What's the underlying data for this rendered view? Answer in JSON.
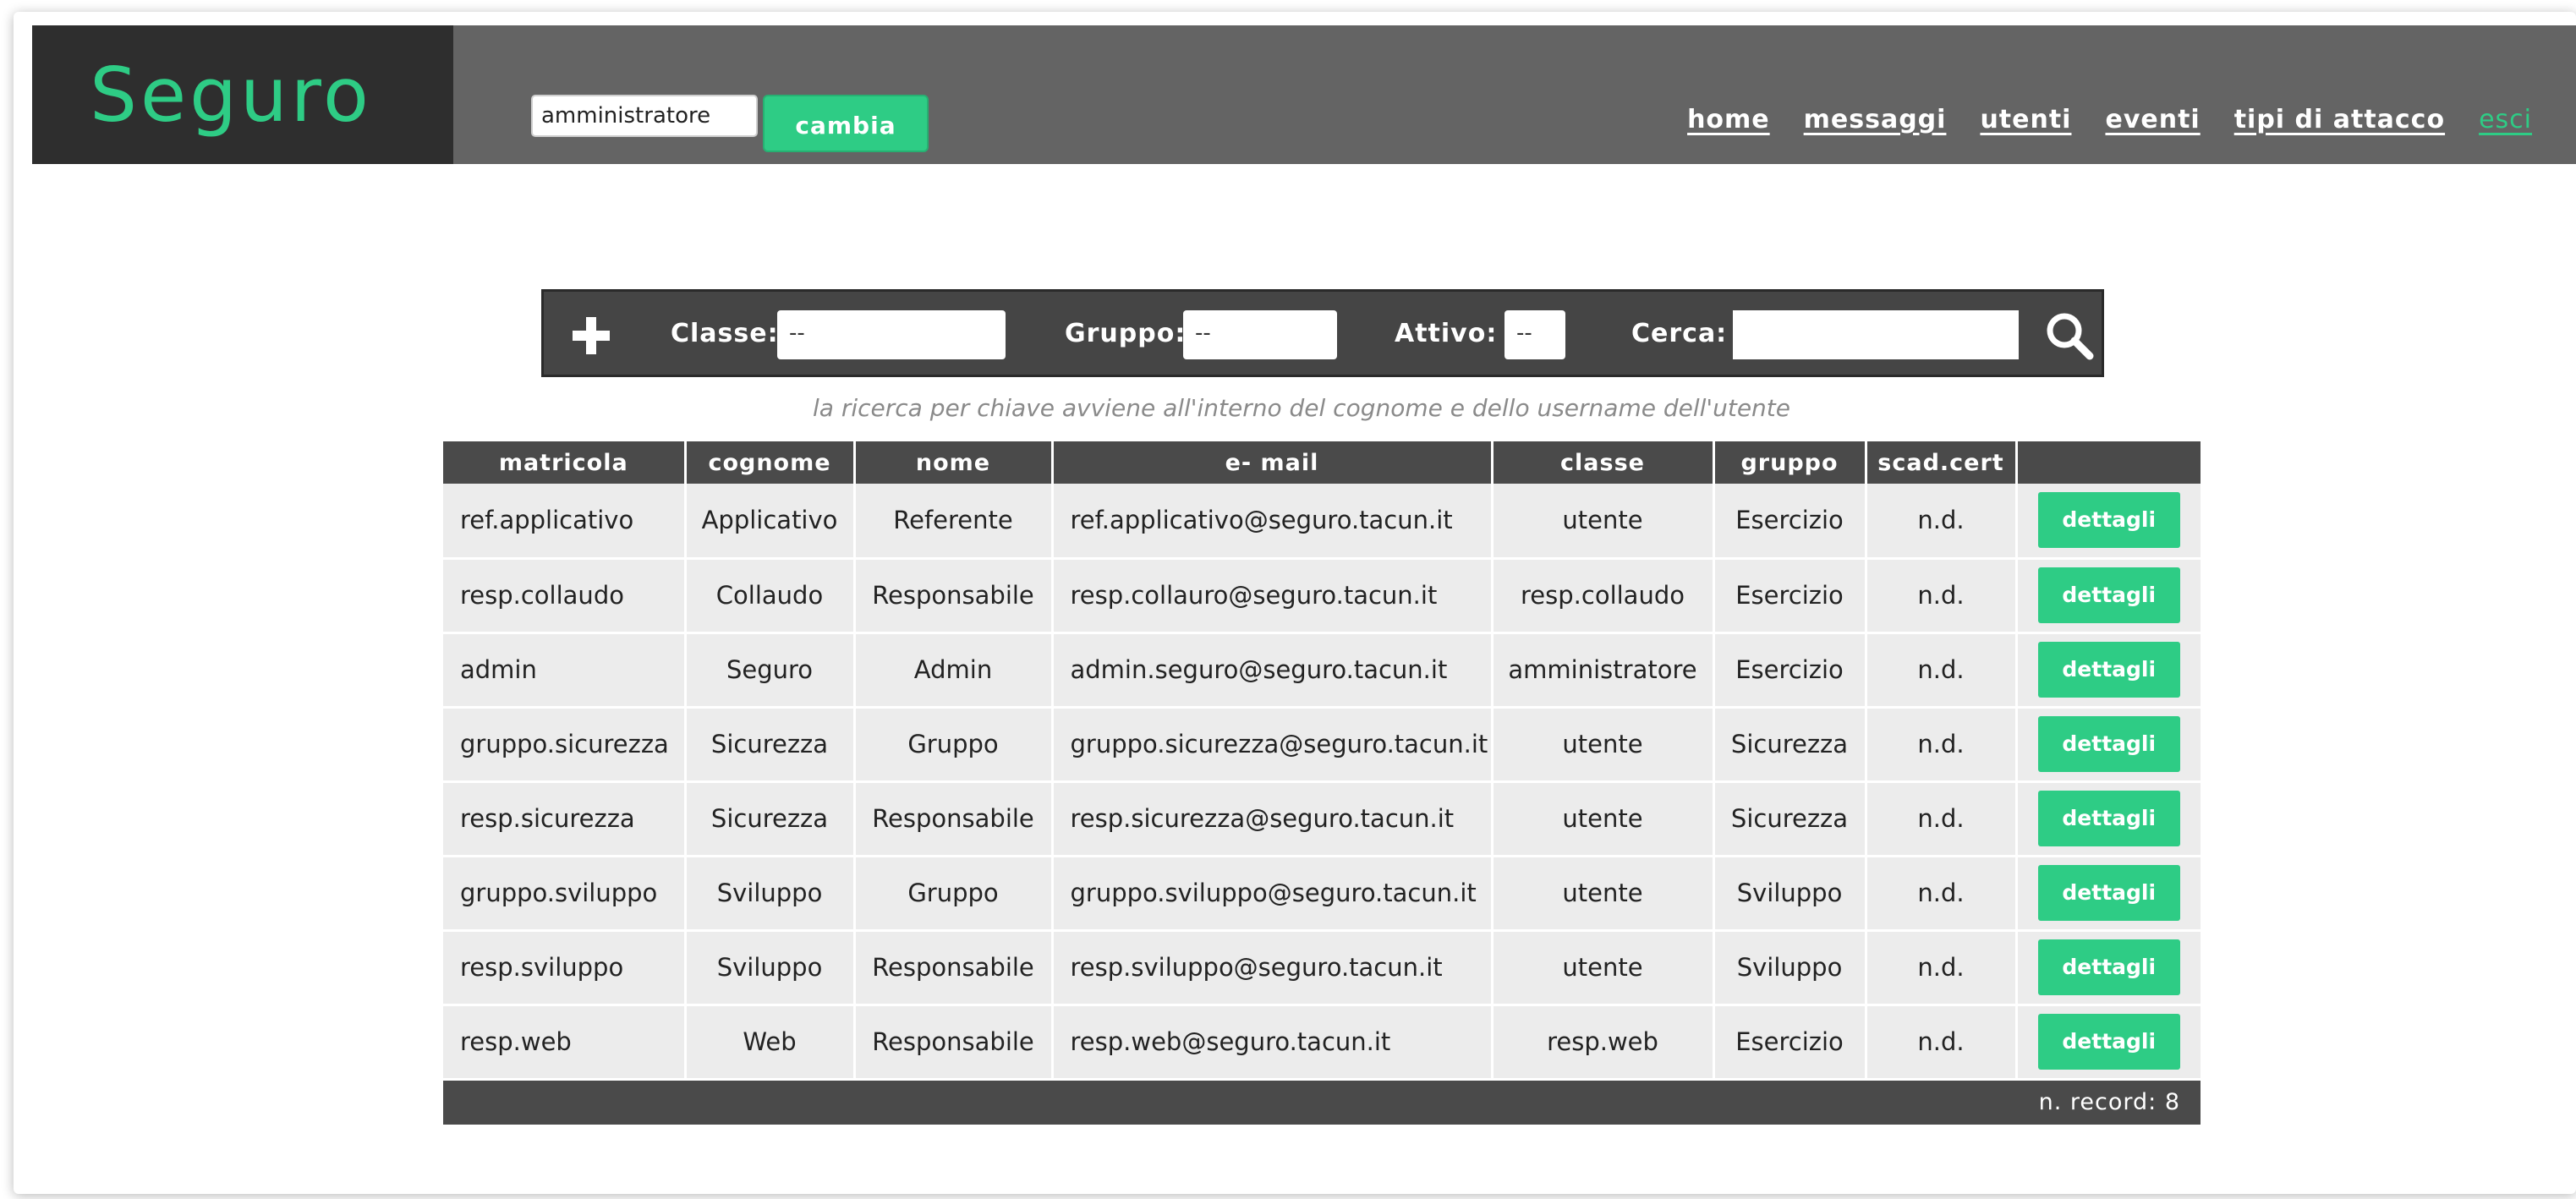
{
  "header": {
    "logo": "Seguro",
    "role_value": "amministratore",
    "change_button": "cambia",
    "nav": [
      {
        "label": "home"
      },
      {
        "label": "messaggi"
      },
      {
        "label": "utenti"
      },
      {
        "label": "eventi"
      },
      {
        "label": "tipi di attacco"
      },
      {
        "label": "esci"
      }
    ]
  },
  "filters": {
    "classe_label": "Classe:",
    "classe_value": "--",
    "gruppo_label": "Gruppo:",
    "gruppo_value": "--",
    "attivo_label": "Attivo:",
    "attivo_value": "--",
    "cerca_label": "Cerca:",
    "cerca_value": ""
  },
  "hint": "la ricerca per chiave avviene all'interno del cognome e dello username dell'utente",
  "table": {
    "columns": [
      "matricola",
      "cognome",
      "nome",
      "e- mail",
      "classe",
      "gruppo",
      "scad.cert",
      ""
    ],
    "rows": [
      [
        "ref.applicativo",
        "Applicativo",
        "Referente",
        "ref.applicativo@seguro.tacun.it",
        "utente",
        "Esercizio",
        "n.d.",
        "dettagli"
      ],
      [
        "resp.collaudo",
        "Collaudo",
        "Responsabile",
        "resp.collauro@seguro.tacun.it",
        "resp.collaudo",
        "Esercizio",
        "n.d.",
        "dettagli"
      ],
      [
        "admin",
        "Seguro",
        "Admin",
        "admin.seguro@seguro.tacun.it",
        "amministratore",
        "Esercizio",
        "n.d.",
        "dettagli"
      ],
      [
        "gruppo.sicurezza",
        "Sicurezza",
        "Gruppo",
        "gruppo.sicurezza@seguro.tacun.it",
        "utente",
        "Sicurezza",
        "n.d.",
        "dettagli"
      ],
      [
        "resp.sicurezza",
        "Sicurezza",
        "Responsabile",
        "resp.sicurezza@seguro.tacun.it",
        "utente",
        "Sicurezza",
        "n.d.",
        "dettagli"
      ],
      [
        "gruppo.sviluppo",
        "Sviluppo",
        "Gruppo",
        "gruppo.sviluppo@seguro.tacun.it",
        "utente",
        "Sviluppo",
        "n.d.",
        "dettagli"
      ],
      [
        "resp.sviluppo",
        "Sviluppo",
        "Responsabile",
        "resp.sviluppo@seguro.tacun.it",
        "utente",
        "Sviluppo",
        "n.d.",
        "dettagli"
      ],
      [
        "resp.web",
        "Web",
        "Responsabile",
        "resp.web@seguro.tacun.it",
        "resp.web",
        "Esercizio",
        "n.d.",
        "dettagli"
      ]
    ],
    "footer": "n. record: 8"
  },
  "colors": {
    "accent": "#2ecc85",
    "header_bg": "#646464",
    "logo_bg": "#2e2e2e",
    "table_header_bg": "#4a4a4a",
    "row_bg": "#ececec"
  },
  "icons": {
    "add": "plus-icon",
    "search": "search-icon"
  }
}
